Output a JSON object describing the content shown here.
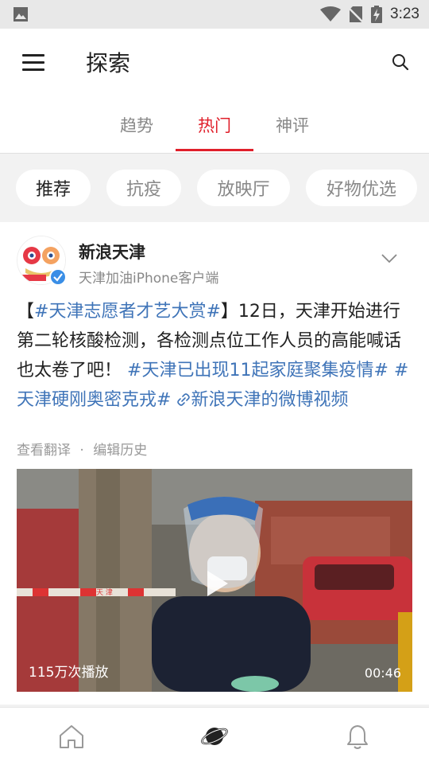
{
  "statusbar": {
    "time": "3:23"
  },
  "appbar": {
    "title": "探索"
  },
  "tabs": [
    {
      "label": "趋势"
    },
    {
      "label": "热门",
      "active": true
    },
    {
      "label": "神评"
    }
  ],
  "chips": [
    {
      "label": "推荐",
      "active": true
    },
    {
      "label": "抗疫"
    },
    {
      "label": "放映厅"
    },
    {
      "label": "好物优选"
    }
  ],
  "post": {
    "username": "新浪天津",
    "source": "天津加油iPhone客户端",
    "text": {
      "bracket_open": "【",
      "tag1": "#天津志愿者才艺大赏#",
      "body": "】12日，天津开始进行第二轮核酸检测，各检测点位工作人员的高能喊话也太卷了吧！",
      "tag2": "#天津已出现11起家庭聚集疫情#",
      "tag3": "#天津硬刚奥密克戎#",
      "link": "新浪天津的微博视频"
    },
    "meta": {
      "translate": "查看翻译",
      "separator": "·",
      "edit_history": "编辑历史"
    },
    "video": {
      "views": "115万次播放",
      "duration": "00:46",
      "banner_text": "天 津"
    }
  },
  "colors": {
    "accent": "#e0202b",
    "link": "#3f74b8"
  }
}
